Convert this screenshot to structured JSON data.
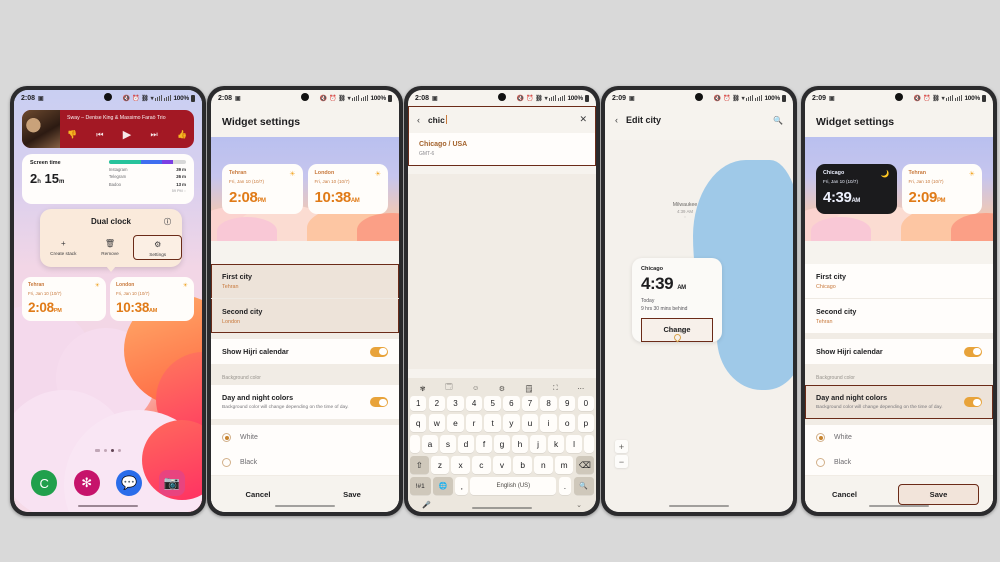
{
  "statusbar": {
    "time_208": "2:08",
    "time_209": "2:09",
    "battery": "100%",
    "mute_icon": "mute-icon",
    "alarm_icon": "alarm-icon",
    "wifi_icon": "wifi-icon"
  },
  "phone1": {
    "music": {
      "title": "Sway – Denise King & Massimo Faraò Trio",
      "dislike": "👎",
      "prev": "⏮",
      "play": "▶",
      "next": "⏭",
      "like": "👍"
    },
    "screentime": {
      "label": "Screen time",
      "value": "2",
      "unit_h": "h",
      "value2": "15",
      "unit_m": "m",
      "apps": [
        {
          "name": "Instagram",
          "time": "39 m",
          "color": "#27c39c"
        },
        {
          "name": "Telegram",
          "time": "26 m",
          "color": "#3f6ef0"
        },
        {
          "name": "Badoo",
          "time": "13 m",
          "color": "#7b3fe4"
        }
      ],
      "footer": "59 PM ◌"
    },
    "popup": {
      "title": "Dual clock",
      "info_icon": "info-icon",
      "actions": [
        {
          "label": "Create stack",
          "icon": "+"
        },
        {
          "label": "Remove",
          "icon": "🗑"
        },
        {
          "label": "Settings",
          "icon": "⚙"
        }
      ]
    },
    "clocks": [
      {
        "city": "Tehran",
        "date": "Fri, Jan 10 (10/7)",
        "time": "2:08",
        "ampm": "PM",
        "icon": "☀"
      },
      {
        "city": "London",
        "date": "Fri, Jan 10 (10/7)",
        "time": "10:38",
        "ampm": "AM",
        "icon": "☀"
      }
    ],
    "dock": [
      {
        "name": "phone-app",
        "glyph": "C"
      },
      {
        "name": "gallery-app",
        "glyph": "✻"
      },
      {
        "name": "messages-app",
        "glyph": "💬"
      },
      {
        "name": "camera-app",
        "glyph": "📷"
      }
    ]
  },
  "phone2": {
    "title": "Widget settings",
    "preview": [
      {
        "city": "Tehran",
        "date": "Fri, Jan 10 (10/7)",
        "time": "2:08",
        "ampm": "PM",
        "icon": "☀"
      },
      {
        "city": "London",
        "date": "Fri, Jan 10 (10/7)",
        "time": "10:38",
        "ampm": "AM",
        "icon": "☀"
      }
    ],
    "first_city_label": "First city",
    "first_city_value": "Tehran",
    "second_city_label": "Second city",
    "second_city_value": "London",
    "hijri_label": "Show Hijri calendar",
    "bg_section": "Background color",
    "daynight_label": "Day and night colors",
    "daynight_desc": "Background color will change depending on the time of day.",
    "white_label": "White",
    "black_label": "Black",
    "cancel": "Cancel",
    "save": "Save"
  },
  "phone3": {
    "search_value": "chic",
    "back_icon": "back-icon",
    "clear_icon": "close-icon",
    "result_title": "Chicago / USA",
    "result_sub": "GMT-6",
    "keyboard": {
      "toolbar": [
        "✾",
        "🗔",
        "☺",
        "⚙",
        "🗒",
        "⛶",
        "⋯"
      ],
      "row_num": [
        "1",
        "2",
        "3",
        "4",
        "5",
        "6",
        "7",
        "8",
        "9",
        "0"
      ],
      "row1": [
        "q",
        "w",
        "e",
        "r",
        "t",
        "y",
        "u",
        "i",
        "o",
        "p"
      ],
      "row2": [
        "a",
        "s",
        "d",
        "f",
        "g",
        "h",
        "j",
        "k",
        "l"
      ],
      "row3_shift": "⇧",
      "row3": [
        "z",
        "x",
        "c",
        "v",
        "b",
        "n",
        "m"
      ],
      "row3_back": "⌫",
      "sym": "!#1",
      "globe": "🌐",
      "comma": ",",
      "space": "English (US)",
      "period": ".",
      "search": "🔍",
      "mic": "🎤",
      "hide": "⌄"
    }
  },
  "phone4": {
    "title": "Edit city",
    "back_icon": "back-icon",
    "search_icon": "search-icon",
    "milwaukee": {
      "city": "Milwaukee",
      "time": "4:39 AM",
      "sub": "◌"
    },
    "card": {
      "city": "Chicago",
      "time": "4:39",
      "ampm": "AM",
      "today": "Today",
      "diff": "9 hrs 30 mins behind",
      "change": "Change"
    },
    "pin_label": "Chicago",
    "zoom_in": "+",
    "zoom_out": "−"
  },
  "phone5": {
    "title": "Widget settings",
    "preview": [
      {
        "city": "Chicago",
        "date": "Fri, Jan 10 (10/7)",
        "time": "4:39",
        "ampm": "AM",
        "icon": "🌙"
      },
      {
        "city": "Tehran",
        "date": "Fri, Jan 10 (10/7)",
        "time": "2:09",
        "ampm": "PM",
        "icon": "☀"
      }
    ],
    "first_city_label": "First city",
    "first_city_value": "Chicago",
    "second_city_label": "Second city",
    "second_city_value": "Tehran",
    "hijri_label": "Show Hijri calendar",
    "bg_section": "Background color",
    "daynight_label": "Day and night colors",
    "daynight_desc": "Background color will change depending on the time of day.",
    "white_label": "White",
    "black_label": "Black",
    "cancel": "Cancel",
    "save": "Save"
  }
}
